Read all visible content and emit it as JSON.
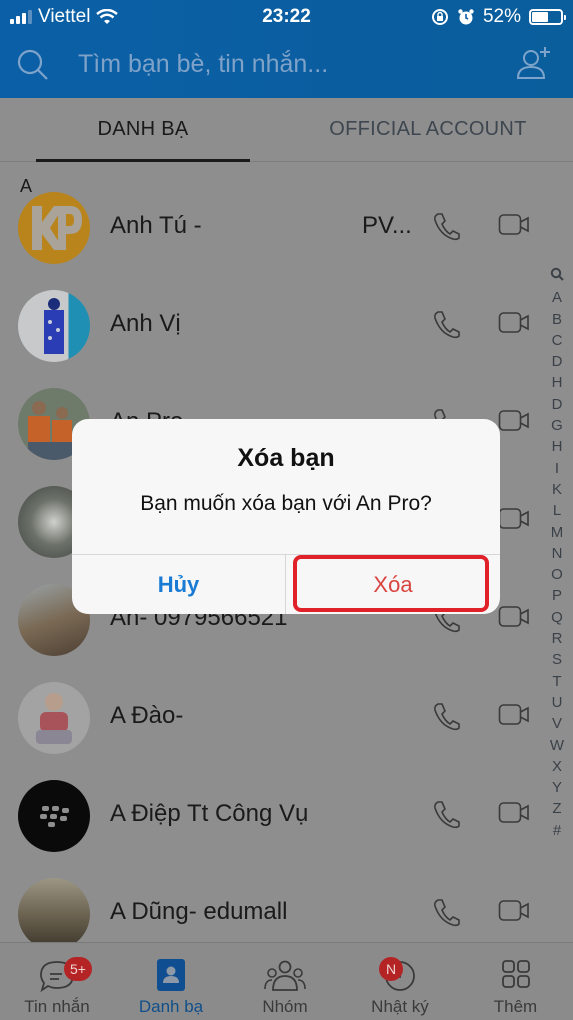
{
  "status_bar": {
    "carrier": "Viettel",
    "time": "23:22",
    "battery_percent": "52%",
    "battery_level": 0.52
  },
  "search": {
    "placeholder": "Tìm bạn bè, tin nhắn...",
    "value": ""
  },
  "tabs": [
    {
      "label": "DANH BẠ",
      "active": true
    },
    {
      "label": "OFFICIAL ACCOUNT",
      "active": false
    }
  ],
  "section_letter": "A",
  "contacts": [
    {
      "name": "Anh Tú -",
      "suffix": "PV...",
      "avatar": "kp-logo"
    },
    {
      "name": "Anh Vị",
      "suffix": "",
      "avatar": "photo-child-blue"
    },
    {
      "name": "An Pro",
      "suffix": "",
      "avatar": "photo-two-men"
    },
    {
      "name": "",
      "suffix": "",
      "avatar": "photo-flower"
    },
    {
      "name": "An- 0979566521",
      "suffix": "",
      "avatar": "photo-building"
    },
    {
      "name": "A Đào-",
      "suffix": "",
      "avatar": "photo-baby"
    },
    {
      "name": "A Điệp Tt Công Vụ",
      "suffix": "",
      "avatar": "blackberry-logo"
    },
    {
      "name": "A Dũng- edumall",
      "suffix": "",
      "avatar": "photo-painting"
    }
  ],
  "alphabet_index": [
    "A",
    "B",
    "C",
    "D",
    "H",
    "D",
    "G",
    "H",
    "I",
    "K",
    "L",
    "M",
    "N",
    "O",
    "P",
    "Q",
    "R",
    "S",
    "T",
    "U",
    "V",
    "W",
    "X",
    "Y",
    "Z",
    "#"
  ],
  "tab_bar": [
    {
      "label": "Tin nhắn",
      "badge": "5+",
      "icon": "chat-icon",
      "active": false
    },
    {
      "label": "Danh bạ",
      "badge": "",
      "icon": "contacts-icon",
      "active": true
    },
    {
      "label": "Nhóm",
      "badge": "",
      "icon": "group-icon",
      "active": false
    },
    {
      "label": "Nhật ký",
      "badge": "N",
      "icon": "clock-icon",
      "active": false
    },
    {
      "label": "Thêm",
      "badge": "",
      "icon": "grid-icon",
      "active": false
    }
  ],
  "dialog": {
    "title": "Xóa bạn",
    "message": "Bạn muốn xóa bạn với An Pro?",
    "cancel_label": "Hủy",
    "confirm_label": "Xóa"
  },
  "colors": {
    "header_blue": "#0b5fa6",
    "cancel_blue": "#1a7bd4",
    "delete_red": "#d9443f",
    "highlight_red": "#e0212a",
    "badge_red": "#b52425"
  }
}
